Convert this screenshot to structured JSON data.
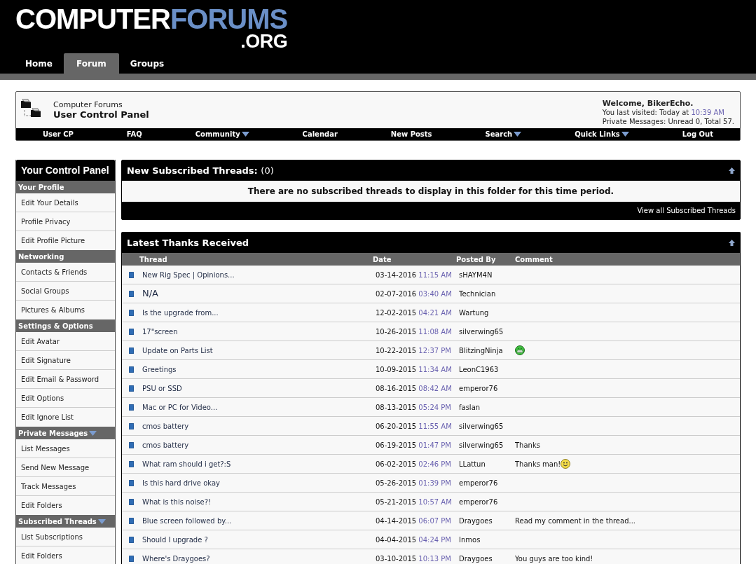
{
  "logo": {
    "word_1": "COMPUTER",
    "word_2": "FORUMS",
    "suffix": ".ORG"
  },
  "tabs": [
    {
      "label": "Home",
      "selected": false
    },
    {
      "label": "Forum",
      "selected": true
    },
    {
      "label": "Groups",
      "selected": false
    }
  ],
  "breadcrumb": {
    "parent": "Computer Forums",
    "current": "User Control Panel"
  },
  "welcome": {
    "greeting": "Welcome, BikerEcho.",
    "last_visited_label": "You last visited: Today at",
    "last_visited_time": "10:39 AM",
    "messages": "Private Messages: Unread 0, Total 57."
  },
  "navbar": [
    {
      "label": "User CP",
      "has_menu": false
    },
    {
      "label": "FAQ",
      "has_menu": false
    },
    {
      "label": "Community",
      "has_menu": true
    },
    {
      "label": "Calendar",
      "has_menu": false
    },
    {
      "label": "New Posts",
      "has_menu": false
    },
    {
      "label": "Search",
      "has_menu": true
    },
    {
      "label": "Quick Links",
      "has_menu": true
    },
    {
      "label": "Log Out",
      "has_menu": false
    }
  ],
  "sidebar": {
    "title": "Your Control Panel",
    "sections": [
      {
        "title": "Your Profile",
        "has_menu": false,
        "items": [
          "Edit Your Details",
          "Profile Privacy",
          "Edit Profile Picture"
        ]
      },
      {
        "title": "Networking",
        "has_menu": false,
        "items": [
          "Contacts & Friends",
          "Social Groups",
          "Pictures & Albums"
        ]
      },
      {
        "title": "Settings & Options",
        "has_menu": false,
        "items": [
          "Edit Avatar",
          "Edit Signature",
          "Edit Email & Password",
          "Edit Options",
          "Edit Ignore List"
        ]
      },
      {
        "title": "Private Messages",
        "has_menu": true,
        "items": [
          "List Messages",
          "Send New Message",
          "Track Messages",
          "Edit Folders"
        ]
      },
      {
        "title": "Subscribed Threads",
        "has_menu": true,
        "items": [
          "List Subscriptions",
          "Edit Folders"
        ]
      }
    ]
  },
  "subscribed": {
    "title": "New Subscribed Threads:",
    "count": "(0)",
    "message": "There are no subscribed threads to display in this folder for this time period.",
    "footer_link": "View all Subscribed Threads"
  },
  "thanks": {
    "title": "Latest Thanks Received",
    "columns": [
      "Thread",
      "Date",
      "Posted By",
      "Comment"
    ],
    "rows": [
      {
        "thread": "New Rig Spec | Opinions...",
        "large": false,
        "date": "03-14-2016",
        "time": "11:15 AM",
        "posted_by": "sHAYM4N"
      },
      {
        "thread": "N/A",
        "large": true,
        "date": "02-07-2016",
        "time": "03:40 AM",
        "posted_by": "Technician"
      },
      {
        "thread": "Is the upgrade from...",
        "large": false,
        "date": "12-02-2015",
        "time": "04:21 AM",
        "posted_by": "Wartung"
      },
      {
        "thread": "17\"screen",
        "large": false,
        "date": "10-26-2015",
        "time": "11:08 AM",
        "posted_by": "silverwing65"
      },
      {
        "thread": "Update on Parts List",
        "large": false,
        "date": "10-22-2015",
        "time": "12:37 PM",
        "posted_by": "BlitzingNinja",
        "emoticon": {
          "kind": "grin"
        }
      },
      {
        "thread": "Greetings",
        "large": false,
        "date": "10-09-2015",
        "time": "11:34 AM",
        "posted_by": "LeonC1963"
      },
      {
        "thread": "PSU or SSD",
        "large": false,
        "date": "08-16-2015",
        "time": "08:42 AM",
        "posted_by": "emperor76"
      },
      {
        "thread": "Mac or PC for Video...",
        "large": false,
        "date": "08-13-2015",
        "time": "05:24 PM",
        "posted_by": "faslan"
      },
      {
        "thread": "cmos battery",
        "large": false,
        "date": "06-20-2015",
        "time": "11:55 AM",
        "posted_by": "silverwing65"
      },
      {
        "thread": "cmos battery",
        "large": false,
        "date": "06-19-2015",
        "time": "01:47 PM",
        "posted_by": "silverwing65",
        "comment": "Thanks"
      },
      {
        "thread": "What ram should i get?:S",
        "large": false,
        "date": "06-02-2015",
        "time": "02:46 PM",
        "posted_by": "LLattun",
        "comment": "Thanks man!",
        "emoticon": {
          "kind": "smile"
        }
      },
      {
        "thread": "Is this hard drive okay",
        "large": false,
        "date": "05-26-2015",
        "time": "01:39 PM",
        "posted_by": "emperor76"
      },
      {
        "thread": "What is this noise?!",
        "large": false,
        "date": "05-21-2015",
        "time": "10:57 AM",
        "posted_by": "emperor76"
      },
      {
        "thread": "Blue screen followed by...",
        "large": false,
        "date": "04-14-2015",
        "time": "06:07 PM",
        "posted_by": "Draygoes",
        "comment": "Read my comment in the thread..."
      },
      {
        "thread": "Should I upgrade ?",
        "large": false,
        "date": "04-04-2015",
        "time": "04:24 PM",
        "posted_by": "Inmos"
      },
      {
        "thread": "Where's Draygoes?",
        "large": false,
        "date": "03-10-2015",
        "time": "10:13 PM",
        "posted_by": "Draygoes",
        "comment": "You guys are too kind!"
      }
    ]
  }
}
